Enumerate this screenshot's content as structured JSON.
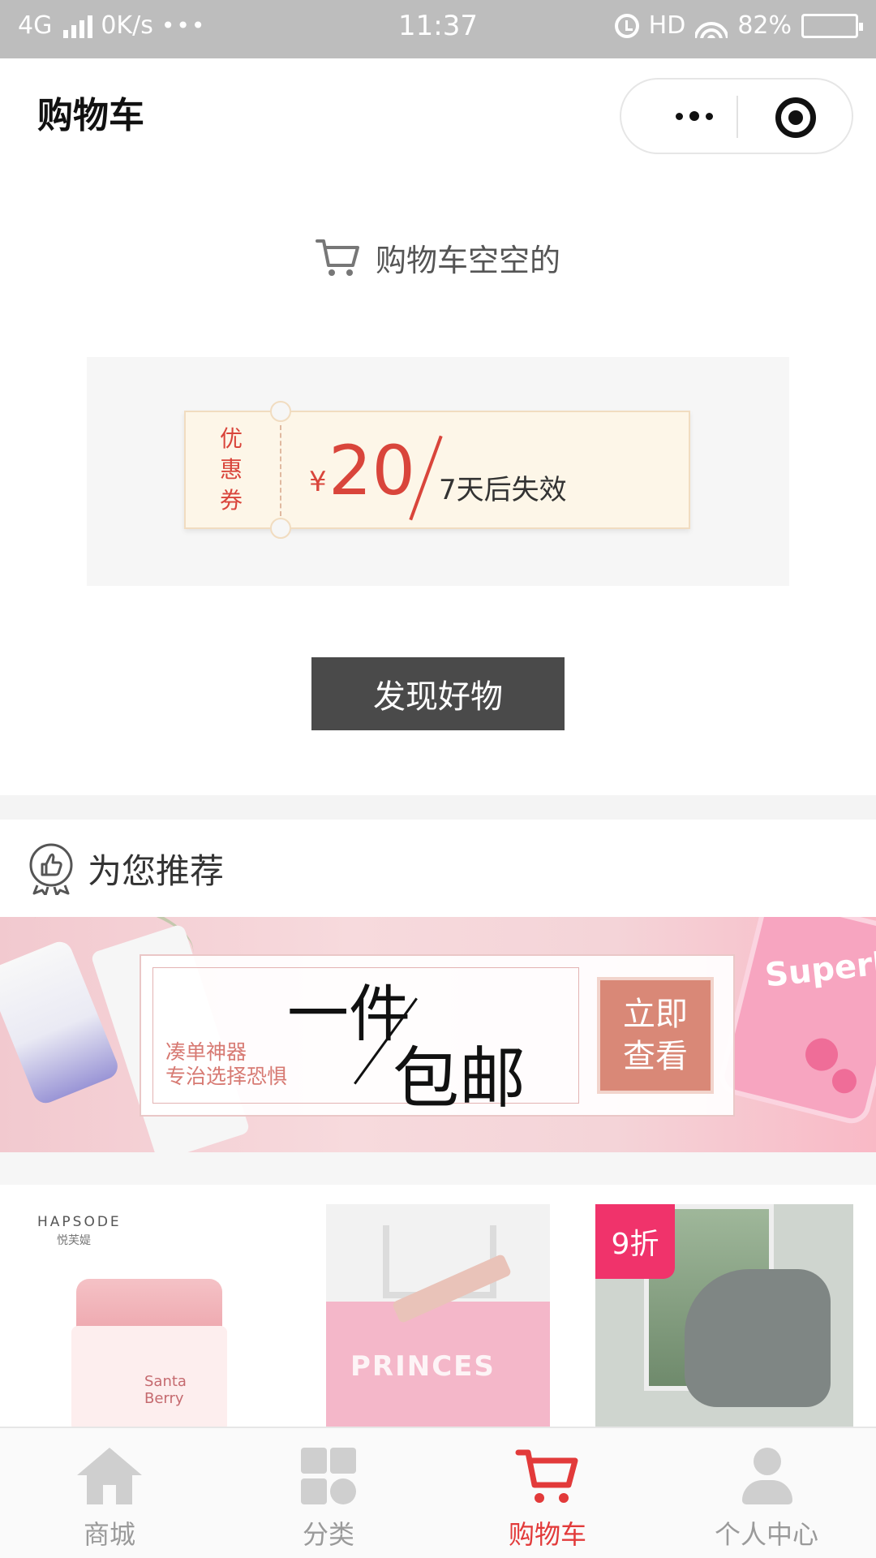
{
  "status_bar": {
    "network": "4G",
    "speed": "0K/s",
    "dots": "•••",
    "time": "11:37",
    "hd": "HD",
    "battery": "82%"
  },
  "nav": {
    "title": "购物车"
  },
  "cart": {
    "empty_text": "购物车空空的",
    "coupon": {
      "label": "优惠券",
      "currency": "¥",
      "amount": "20",
      "expire": "7天后失效"
    },
    "discover_button": "发现好物"
  },
  "recommend": {
    "title": "为您推荐",
    "banner": {
      "sub_line1": "凑单神器",
      "sub_line2": "专治选择恐惧",
      "headline1": "一件",
      "headline2": "包邮",
      "cta_line1": "立即",
      "cta_line2": "查看",
      "deco_text": "SuperBoin"
    },
    "products": [
      {
        "brand": "HAPSODE",
        "brand_cn": "悦芙媞",
        "product_text": "Santa Berry"
      },
      {
        "product_text": "PRINCES"
      },
      {
        "badge": "9折"
      }
    ]
  },
  "tab_bar": {
    "items": [
      {
        "label": "商城",
        "icon": "home-icon",
        "active": false
      },
      {
        "label": "分类",
        "icon": "category-icon",
        "active": false
      },
      {
        "label": "购物车",
        "icon": "cart-icon",
        "active": true
      },
      {
        "label": "个人中心",
        "icon": "user-icon",
        "active": false
      }
    ]
  },
  "colors": {
    "accent_red": "#e23a3a",
    "coupon_red": "#d9453b",
    "button_dark": "#4a4a4a",
    "status_bar": "#bdbdbd",
    "badge_pink": "#f0336b"
  }
}
